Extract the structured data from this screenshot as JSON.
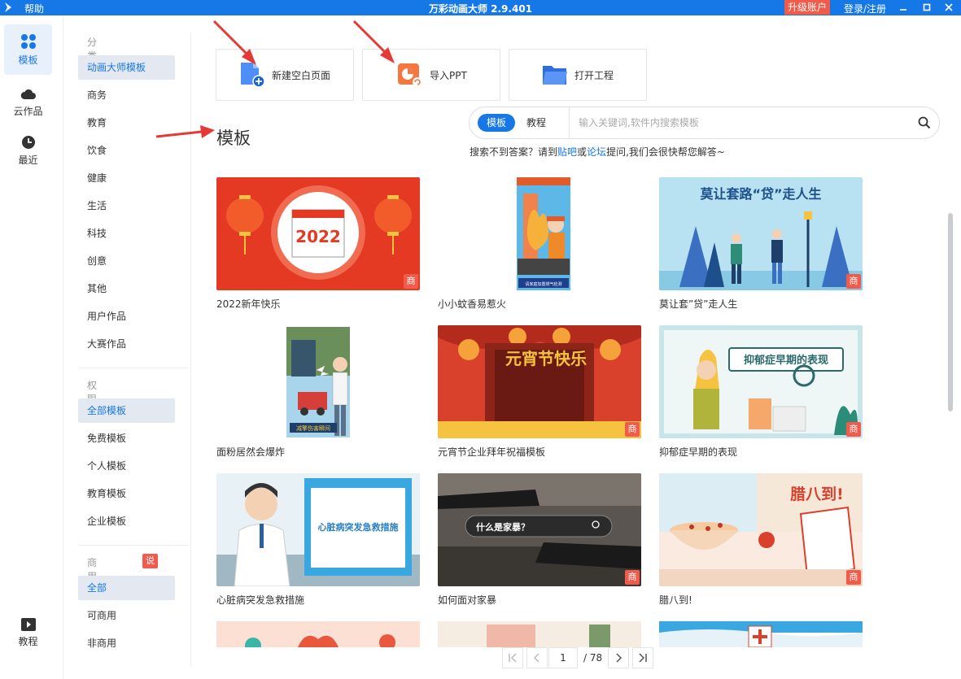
{
  "titlebar": {
    "help": "帮助",
    "title": "万彩动画大师 2.9.401",
    "upgrade": "升级账户",
    "login": "登录/注册"
  },
  "leftnav": [
    {
      "label": "模板",
      "icon": "grid-icon"
    },
    {
      "label": "云作品",
      "icon": "cloud-icon"
    },
    {
      "label": "最近",
      "icon": "clock-icon"
    },
    {
      "label": "教程",
      "icon": "video-icon"
    }
  ],
  "categories": {
    "section1_title": "分类",
    "section1": [
      "动画大师模板",
      "商务",
      "教育",
      "饮食",
      "健康",
      "生活",
      "科技",
      "创意",
      "其他",
      "用户作品",
      "大赛作品"
    ],
    "section2_title": "权限",
    "section2": [
      "全部模板",
      "免费模板",
      "个人模板",
      "教育模板",
      "企业模板"
    ],
    "section3_title": "商用",
    "section3_badge": "说明",
    "section3": [
      "全部",
      "可商用",
      "非商用"
    ]
  },
  "actions": {
    "new_blank": "新建空白页面",
    "import_ppt": "导入PPT",
    "open_project": "打开工程"
  },
  "page_title": "模板",
  "search": {
    "tab_active": "模板",
    "tab_other": "教程",
    "placeholder": "输入关键词,软件内搜索模板"
  },
  "hint": {
    "pre": "搜索不到答案？请到",
    "link1": "贴吧",
    "mid": "或",
    "link2": "论坛",
    "post": "提问,我们会很快帮您解答~"
  },
  "templates": [
    {
      "name": "2022新年快乐",
      "badge": "商",
      "thumb_text": "2022"
    },
    {
      "name": "小小蚊香易惹火",
      "badge": "",
      "thumb_text": "请家庭加置燃气检测"
    },
    {
      "name": "莫让套”贷”走人生",
      "badge": "商",
      "thumb_text": "莫让套路“贷”走人生"
    },
    {
      "name": "面粉居然会爆炸",
      "badge": "",
      "thumb_text": "减擎伤害瞬间"
    },
    {
      "name": "元宵节企业拜年祝福模板",
      "badge": "商",
      "thumb_text": "元宵节快乐"
    },
    {
      "name": "抑郁症早期的表现",
      "badge": "商",
      "thumb_text": "抑郁症早期的表现"
    },
    {
      "name": "心脏病突发急救措施",
      "badge": "",
      "thumb_text": "心脏病突发急救措施"
    },
    {
      "name": "如何面对家暴",
      "badge": "商",
      "thumb_text": "什么是家暴？"
    },
    {
      "name": "腊八到!",
      "badge": "商",
      "thumb_text": "腊八到!"
    }
  ],
  "pagination": {
    "current": "1",
    "total": "/ 78"
  },
  "colors": {
    "accent": "#1677e6",
    "badge": "#f25a4a",
    "selected_bg": "#e4e9f1"
  }
}
